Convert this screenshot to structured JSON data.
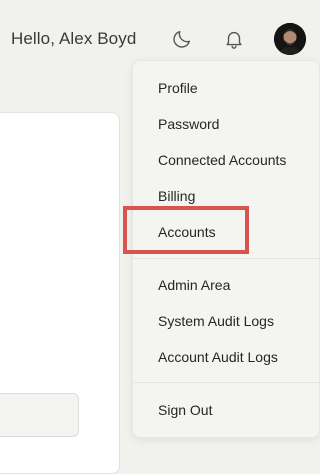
{
  "header": {
    "greeting": "Hello, Alex Boyd",
    "icons": [
      "moon-icon",
      "bell-icon"
    ],
    "avatar_alt": "user-avatar"
  },
  "dropdown": {
    "items": [
      {
        "label": "Profile"
      },
      {
        "label": "Password"
      },
      {
        "label": "Connected Accounts"
      },
      {
        "label": "Billing"
      },
      {
        "label": "Accounts"
      },
      {
        "label": "Admin Area"
      },
      {
        "label": "System Audit Logs"
      },
      {
        "label": "Account Audit Logs"
      },
      {
        "label": "Sign Out"
      }
    ],
    "highlighted_item": "Accounts",
    "highlight_color": "#d9534f"
  }
}
